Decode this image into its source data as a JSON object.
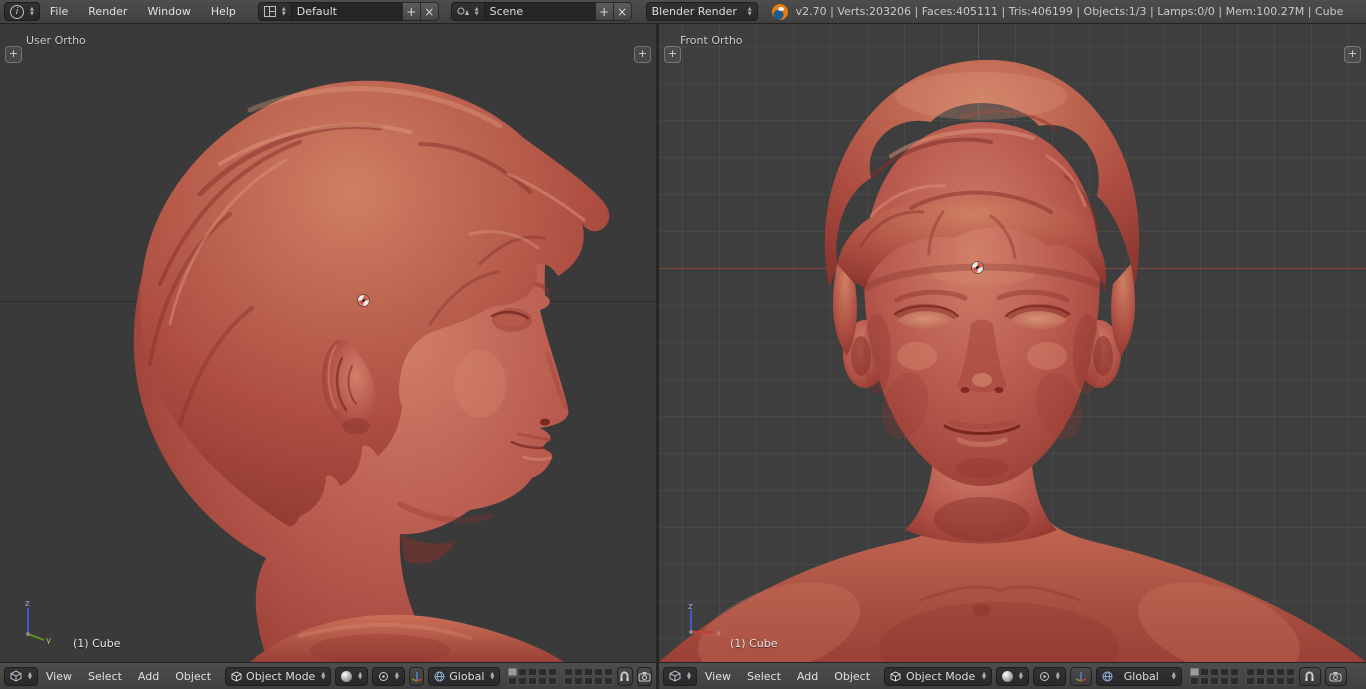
{
  "header": {
    "menus": [
      "File",
      "Render",
      "Window",
      "Help"
    ],
    "screen": {
      "name": "Default"
    },
    "scene": {
      "name": "Scene"
    },
    "engine": "Blender Render",
    "stats": "v2.70 | Verts:203206 | Faces:405111 | Tris:406199 | Objects:1/3 | Lamps:0/0 | Mem:100.27M | Cube"
  },
  "viewports": {
    "left": {
      "view_label": "User Ortho",
      "object_label": "(1) Cube"
    },
    "right": {
      "view_label": "Front Ortho",
      "object_label": "(1) Cube"
    }
  },
  "view_header": {
    "menus": [
      "View",
      "Select",
      "Add",
      "Object"
    ],
    "mode_label": "Object Mode",
    "orientation_label": "Global"
  },
  "gizmo": {
    "x_label": "x",
    "y_label": "y",
    "z_label": "z"
  },
  "icons": {
    "add": "+",
    "close": "×",
    "info": "i"
  },
  "colors": {
    "header_bg": "#454545",
    "viewport_bg": "#3b3b3b",
    "clay_base": "#b5544a",
    "clay_highlight": "#d2806a",
    "clay_shadow": "#8c332c",
    "axis_red": "#96423e",
    "accent_orange": "#e87d0d"
  }
}
